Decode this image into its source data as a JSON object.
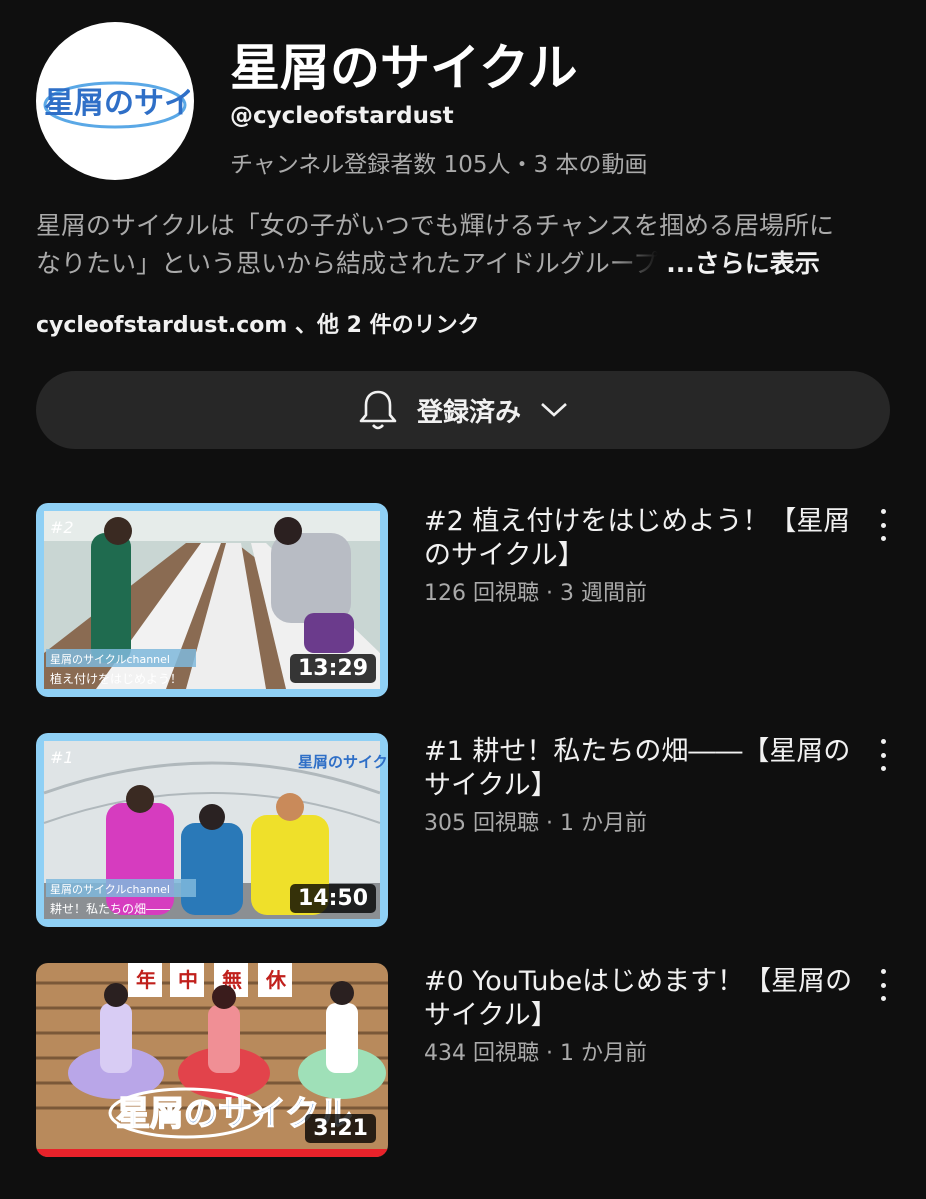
{
  "channel": {
    "name": "星屑のサイクル",
    "handle": "@cycleofstardust",
    "stats": "チャンネル登録者数 105人・3 本の動画",
    "avatar_logo_text": "星屑のサイクル",
    "description_line1": "星屑のサイクルは「女の子がいつでも輝けるチャンスを掴める居場所に",
    "description_line2": "なりたい」という思いから結成されたアイドルグル",
    "description_fade": "ープ",
    "description_more": "...さらに表示",
    "links": "cycleofstardust.com 、他 2 件のリンク"
  },
  "subscribe_button": {
    "label": "登録済み",
    "icon": "bell-icon",
    "dropdown_icon": "chevron-down-icon"
  },
  "videos": [
    {
      "title": "#2 植え付けをはじめよう！【星屑のサイクル】",
      "meta": "126 回視聴 · 3 週間前",
      "duration": "13:29",
      "thumb_number": "#2",
      "thumb_caption_top": "星屑のサイクルchannel",
      "thumb_caption_bottom": "植え付けをはじめよう！"
    },
    {
      "title": "#1 耕せ！私たちの畑――【星屑のサイクル】",
      "meta": "305 回視聴 · 1 か月前",
      "duration": "14:50",
      "thumb_number": "#1",
      "thumb_caption_top": "星屑のサイクルchannel",
      "thumb_caption_bottom": "耕せ！私たちの畑――"
    },
    {
      "title": "#0 YouTubeはじめます！【星屑のサイクル】",
      "meta": "434 回視聴 · 1 か月前",
      "duration": "3:21",
      "thumb_sign": [
        "年",
        "中",
        "無",
        "休"
      ]
    }
  ],
  "colors": {
    "background": "#0f0f0f",
    "button_bg": "#272727",
    "secondary_text": "#aaaaaa",
    "thumb_border_blue": "#8fd0f5"
  }
}
